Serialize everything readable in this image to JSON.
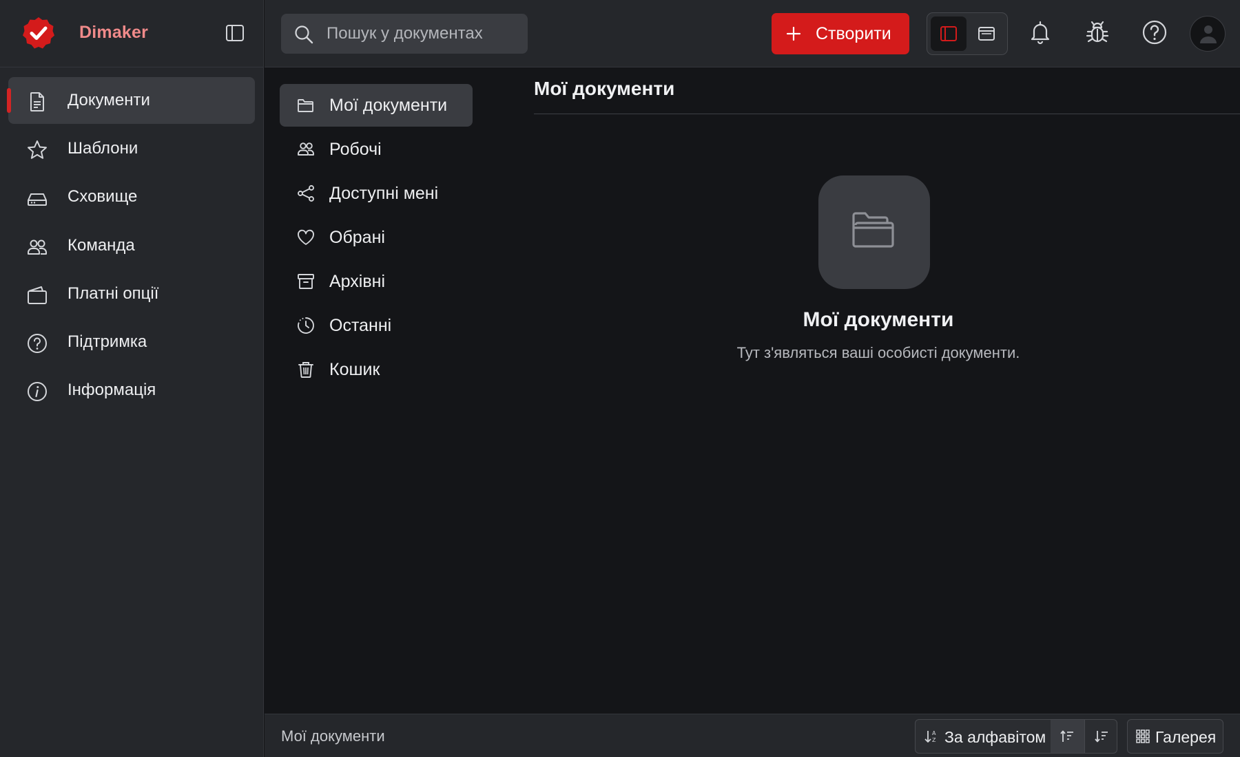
{
  "brand": {
    "name": "Dimaker"
  },
  "colors": {
    "accent": "#d41b1b",
    "brand_text": "#f08a8a",
    "sidebar_bg": "#25272b",
    "content_bg": "#141518"
  },
  "sidebar": {
    "items": [
      {
        "label": "Документи",
        "icon": "document-icon",
        "active": true
      },
      {
        "label": "Шаблони",
        "icon": "star-icon"
      },
      {
        "label": "Сховище",
        "icon": "storage-icon"
      },
      {
        "label": "Команда",
        "icon": "team-icon"
      },
      {
        "label": "Платні опції",
        "icon": "wallet-icon"
      },
      {
        "label": "Підтримка",
        "icon": "help-icon"
      },
      {
        "label": "Інформація",
        "icon": "info-icon"
      }
    ]
  },
  "topbar": {
    "search_placeholder": "Пошук у документах",
    "create_label": "Створити"
  },
  "folders": {
    "items": [
      {
        "label": "Мої документи",
        "icon": "folder-icon",
        "active": true
      },
      {
        "label": "Робочі",
        "icon": "users-icon"
      },
      {
        "label": "Доступні мені",
        "icon": "share-icon"
      },
      {
        "label": "Обрані",
        "icon": "heart-icon"
      },
      {
        "label": "Архівні",
        "icon": "archive-icon"
      },
      {
        "label": "Останні",
        "icon": "clock-icon"
      },
      {
        "label": "Кошик",
        "icon": "trash-icon"
      }
    ]
  },
  "main": {
    "title": "Мої документи",
    "empty_title": "Мої документи",
    "empty_subtitle": "Тут з'являться ваші особисті документи."
  },
  "statusbar": {
    "location": "Мої документи",
    "sort_label": "За алфавітом",
    "view_label": "Галерея"
  }
}
